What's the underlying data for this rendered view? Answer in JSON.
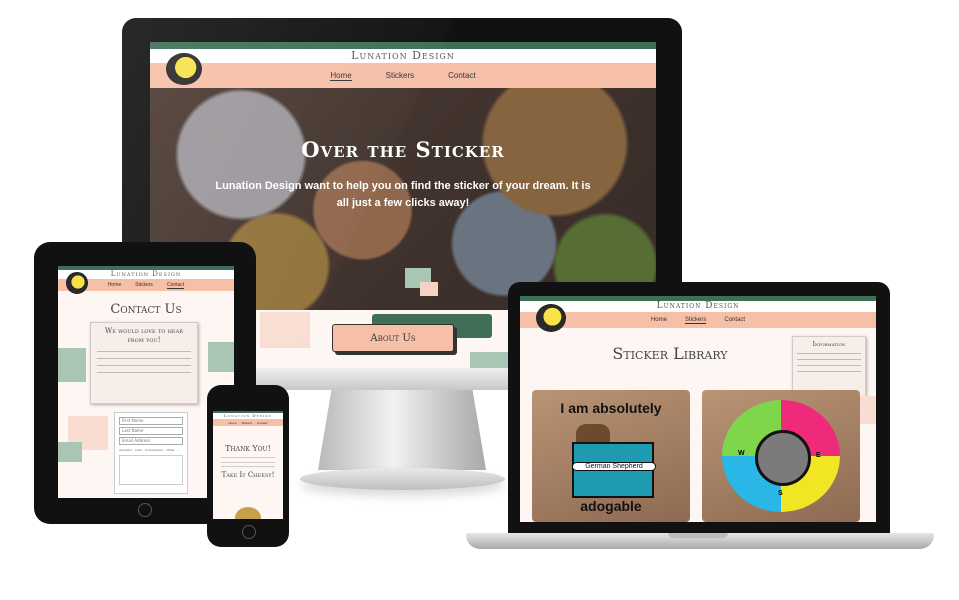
{
  "colors": {
    "brand_green": "#3f6f57",
    "brand_peach": "#f6bfa8",
    "page_bg": "#fdf6f3"
  },
  "site": {
    "title": "Lunation Design",
    "nav": [
      "Home",
      "Stickers",
      "Contact"
    ]
  },
  "desktop": {
    "active_nav": "Home",
    "hero_title": "Over the Sticker",
    "hero_text": "Lunation Design want to help you on find the sticker of your dream. It is all just a few clicks away!",
    "about_button": "About Us"
  },
  "tablet": {
    "active_nav": "Contact",
    "page_title": "Contact Us",
    "card_title": "We would love to hear from you!",
    "form_placeholders": [
      "First Name",
      "Last Name",
      "Email Address"
    ],
    "form_options": [
      "Question",
      "Idea",
      "Commission",
      "Other"
    ]
  },
  "laptop": {
    "active_nav": "Stickers",
    "page_title": "Sticker Library",
    "info_title": "Information",
    "sticker_1_top": "I am absolutely",
    "sticker_1_banner": "German Shepherd",
    "sticker_1_bottom": "adogable",
    "compass_letters": [
      "W",
      "E",
      "S"
    ]
  },
  "phone": {
    "thank_title": "Thank You!",
    "cheesy_title": "Take It Cheesy!"
  },
  "icons": [
    "logo-icon",
    "home-button-icon"
  ]
}
